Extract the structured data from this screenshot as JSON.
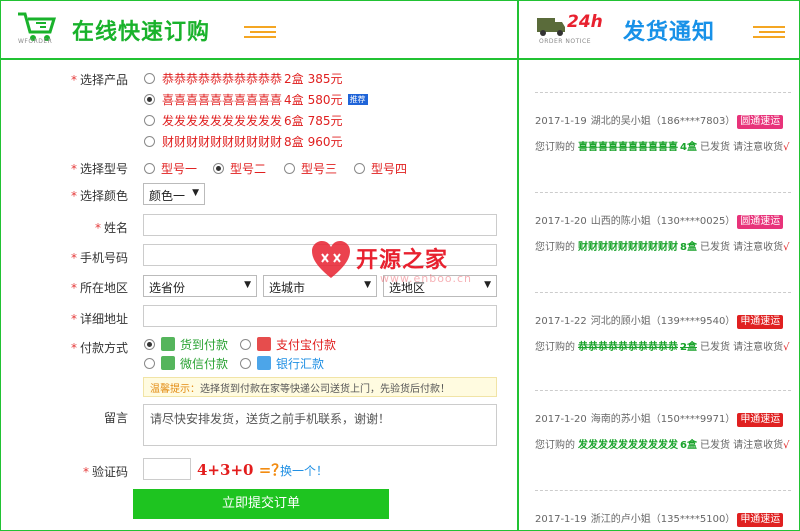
{
  "order": {
    "title": "在线快速订购",
    "subtitle": "WFORDER",
    "fields": {
      "product_label": "选择产品",
      "model_label": "选择型号",
      "color_label": "选择颜色",
      "name_label": "姓名",
      "phone_label": "手机号码",
      "region_label": "所在地区",
      "address_label": "详细地址",
      "payment_label": "付款方式",
      "message_label": "留言",
      "captcha_label": "验证码"
    },
    "required_mark": "*",
    "products": [
      {
        "name": "恭恭恭恭恭恭恭恭恭恭",
        "qty": "2盒",
        "price": "385元",
        "selected": false
      },
      {
        "name": "喜喜喜喜喜喜喜喜喜喜",
        "qty": "4盒",
        "price": "580元",
        "selected": true,
        "badge": "推荐"
      },
      {
        "name": "发发发发发发发发发发",
        "qty": "6盒",
        "price": "785元",
        "selected": false
      },
      {
        "name": "财财财财财财财财财财",
        "qty": "8盒",
        "price": "960元",
        "selected": false
      }
    ],
    "models": [
      {
        "label": "型号一",
        "selected": false
      },
      {
        "label": "型号二",
        "selected": true
      },
      {
        "label": "型号三",
        "selected": false
      },
      {
        "label": "型号四",
        "selected": false
      }
    ],
    "color_value": "颜色一",
    "name_value": "",
    "phone_value": "",
    "province": "选省份",
    "city": "选城市",
    "district": "选地区",
    "address_value": "",
    "payments": [
      {
        "label": "货到付款",
        "selected": true,
        "color": "#2aa233",
        "icon": "coins-icon"
      },
      {
        "label": "支付宝付款",
        "selected": false,
        "color": "#e02020",
        "icon": "alipay-icon"
      },
      {
        "label": "微信付款",
        "selected": false,
        "color": "#2aa233",
        "icon": "wechat-icon"
      },
      {
        "label": "银行汇款",
        "selected": false,
        "color": "#1f8fe3",
        "icon": "bank-card-icon"
      }
    ],
    "tip_label": "温馨提示：",
    "tip_text": "选择货到付款在家等快递公司送货上门，先验货后付款！",
    "message_value": "请尽快安排发货，送货之前手机联系，谢谢！",
    "captcha_value": "",
    "captcha_question": "4+3+0",
    "captcha_eq": "=？",
    "captcha_refresh": "换一个！",
    "submit_label": "立即提交订单"
  },
  "watermark": {
    "text": "开源之家",
    "url": "www.enboo.cn"
  },
  "notice": {
    "title": "发货通知",
    "badge": "24h",
    "subtitle": "ORDER NOTICE",
    "prefix": "您订购的",
    "status": "已发货 请注意收货",
    "check": "√",
    "items": [
      {
        "date": "2017-1-19",
        "who": "湖北的吴小姐",
        "phone": "（186****7803）",
        "ship": "圆通速运",
        "ship_color": "#e8337a",
        "product": "喜喜喜喜喜喜喜喜喜喜",
        "qty": "4盒",
        "strike": false
      },
      {
        "date": "2017-1-20",
        "who": "山西的陈小姐",
        "phone": "（130****0025）",
        "ship": "圆通速运",
        "ship_color": "#e8337a",
        "product": "财财财财财财财财财财",
        "qty": "8盒",
        "strike": false
      },
      {
        "date": "2017-1-22",
        "who": "河北的顾小姐",
        "phone": "（139****9540）",
        "ship": "申通速运",
        "ship_color": "#e02020",
        "product": "恭恭恭恭恭恭恭恭恭恭",
        "qty": "2盒",
        "strike": true
      },
      {
        "date": "2017-1-20",
        "who": "海南的苏小姐",
        "phone": "（150****9971）",
        "ship": "申通速运",
        "ship_color": "#e02020",
        "product": "发发发发发发发发发发",
        "qty": "6盒",
        "strike": false
      },
      {
        "date": "2017-1-19",
        "who": "浙江的卢小姐",
        "phone": "（135****5100）",
        "ship": "申通速运",
        "ship_color": "#e02020",
        "product": "",
        "qty": "",
        "strike": false
      }
    ]
  }
}
